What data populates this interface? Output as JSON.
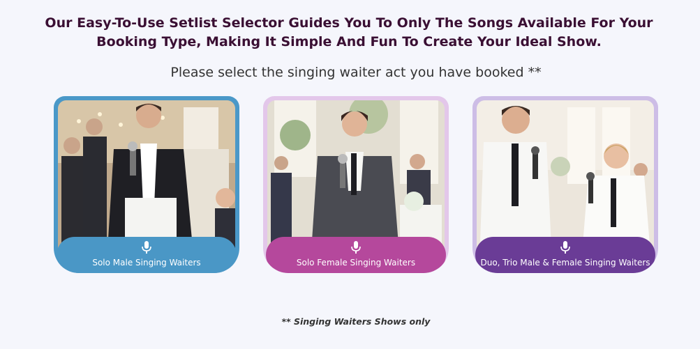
{
  "header": {
    "headline": "Our Easy-To-Use Setlist Selector Guides You To Only The Songs Available For Your Booking Type, Making It Simple And Fun To Create Your Ideal Show.",
    "subtitle": "Please select the singing waiter act you have booked **"
  },
  "cards": [
    {
      "label": "Solo Male Singing Waiters",
      "icon": "microphone-icon",
      "frame_color": "#4a98c8",
      "pill_color": "#4a97c6"
    },
    {
      "label": "Solo Female Singing Waiters",
      "icon": "microphone-icon",
      "frame_color": "#e3c7ea",
      "pill_color": "#b5489c"
    },
    {
      "label": "Duo, Trio Male & Female Singing Waiters",
      "icon": "microphone-icon",
      "frame_color": "#cdbde6",
      "pill_color": "#6a3c96"
    }
  ],
  "footer": {
    "note_stars": "**",
    "note_text": "Singing Waiters Shows only"
  }
}
